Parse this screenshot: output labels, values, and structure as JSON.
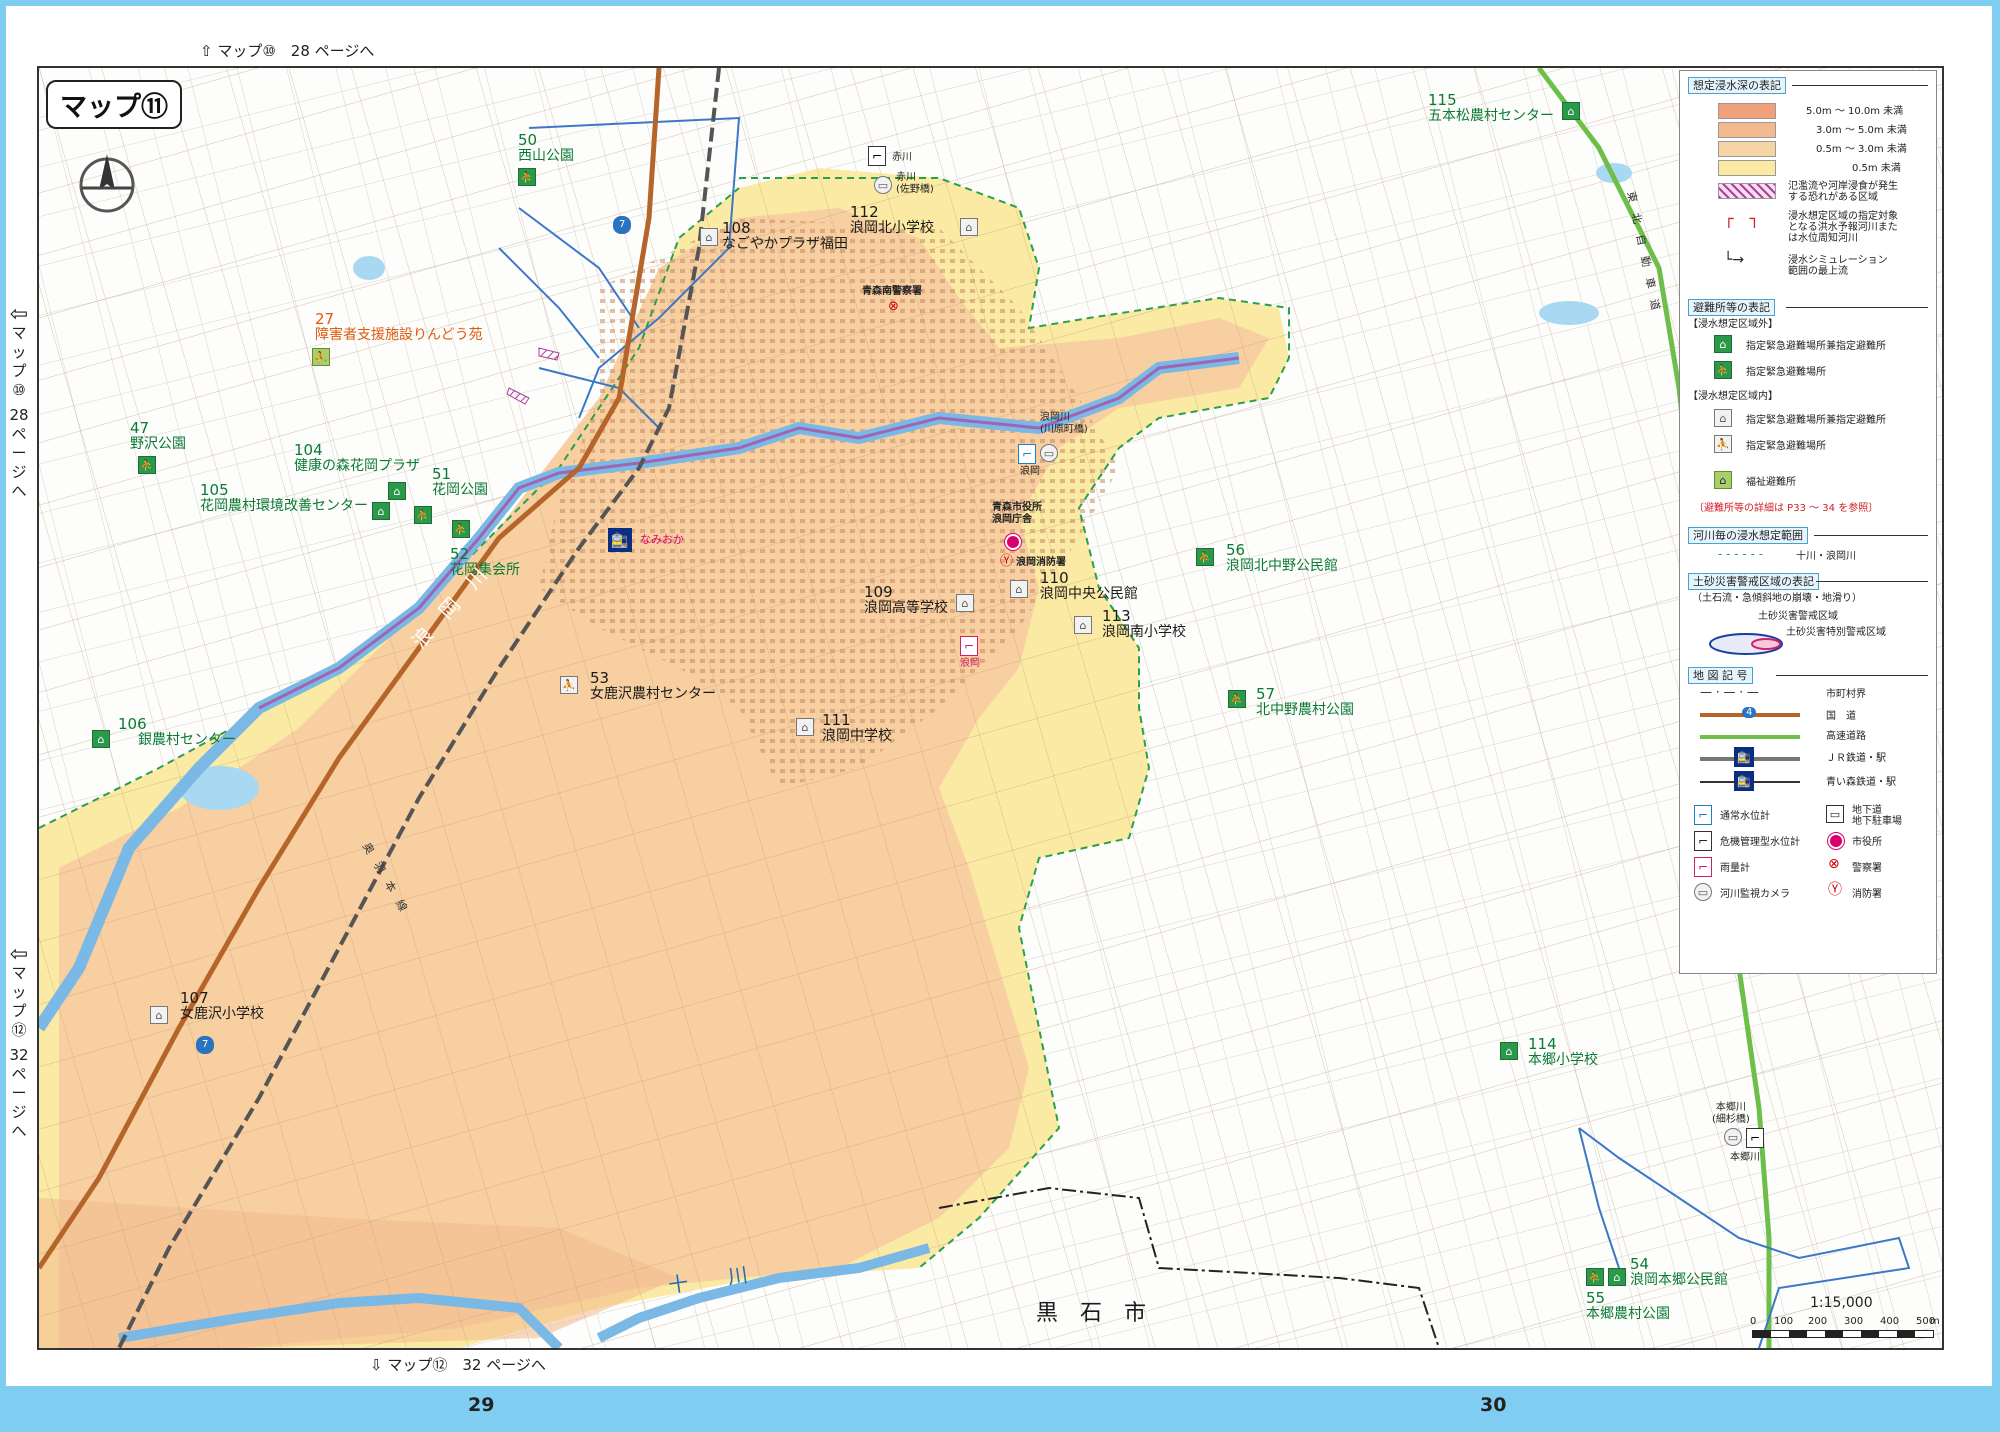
{
  "map_title": "マップ⑪",
  "nav": {
    "top": "マップ⑩　28 ページへ",
    "bottom": "マップ⑫　32 ページへ",
    "left_upper": [
      "マ",
      "ッ",
      "プ",
      "⑩",
      "",
      "28",
      "ペ",
      "ー",
      "ジ",
      "へ"
    ],
    "left_lower": [
      "マ",
      "ッ",
      "プ",
      "⑫",
      "",
      "32",
      "ペ",
      "ー",
      "ジ",
      "へ"
    ]
  },
  "page_numbers": [
    "29",
    "30"
  ],
  "facilities": [
    {
      "num": "50",
      "name": "西山公園",
      "color": "green"
    },
    {
      "num": "27",
      "name": "障害者支援施設りんどう苑",
      "color": "orange"
    },
    {
      "num": "47",
      "name": "野沢公園",
      "color": "green"
    },
    {
      "num": "104",
      "name": "健康の森花岡プラザ",
      "color": "green"
    },
    {
      "num": "51",
      "name": "花岡公園",
      "color": "green"
    },
    {
      "num": "105",
      "name": "花岡農村環境改善センター",
      "color": "green"
    },
    {
      "num": "52",
      "name": "花岡集会所",
      "color": "green"
    },
    {
      "num": "106",
      "name": "銀農村センター",
      "color": "green"
    },
    {
      "num": "107",
      "name": "女鹿沢小学校",
      "color": "black"
    },
    {
      "num": "53",
      "name": "女鹿沢農村センター",
      "color": "black"
    },
    {
      "num": "108",
      "name": "なごやかプラザ福田",
      "color": "black"
    },
    {
      "num": "112",
      "name": "浪岡北小学校",
      "color": "black"
    },
    {
      "num": "109",
      "name": "浪岡高等学校",
      "color": "black"
    },
    {
      "num": "110",
      "name": "浪岡中央公民館",
      "color": "black"
    },
    {
      "num": "113",
      "name": "浪岡南小学校",
      "color": "black"
    },
    {
      "num": "111",
      "name": "浪岡中学校",
      "color": "black"
    },
    {
      "num": "56",
      "name": "浪岡北中野公民館",
      "color": "green"
    },
    {
      "num": "57",
      "name": "北中野農村公園",
      "color": "green"
    },
    {
      "num": "115",
      "name": "五本松農村センター",
      "color": "green"
    },
    {
      "num": "114",
      "name": "本郷小学校",
      "color": "green"
    },
    {
      "num": "54",
      "name": "浪岡本郷公民館",
      "color": "green"
    },
    {
      "num": "55",
      "name": "本郷農村公園",
      "color": "green"
    }
  ],
  "places": {
    "station": "なみおか",
    "city_office": "青森市役所\n浪岡庁舎",
    "fire_station": "浪岡消防署",
    "police": "青森南警察署",
    "gauge_akagawa": "赤川",
    "akagawa_bridge": "赤川\n(佐野橋)",
    "namioka_bridge": "浪岡川\n(川原町橋)",
    "gauge_namioka": "浪岡",
    "rain_namioka": "浪岡",
    "hongo_bridge": "本郷川\n(細杉橋)",
    "gauge_hongo": "本郷川",
    "city_kuroishi": "黒　石　市",
    "river_namioka": "浪　岡　川",
    "river_jukkawa": "十　　川",
    "rail_ou": "奥　羽　本　線",
    "expressway": "東　北　自　動　車　道",
    "route7": "7"
  },
  "legend": {
    "flood_title": "想定浸水深の表記",
    "depths": [
      {
        "label": "5.0m ～ 10.0m 未満",
        "color": "#f0a17c"
      },
      {
        "label": "3.0m ～ 5.0m 未満",
        "color": "#f4b98e"
      },
      {
        "label": "0.5m ～ 3.0m 未満",
        "color": "#f7d4a6"
      },
      {
        "label": "0.5m 未満",
        "color": "#fbeaa3"
      }
    ],
    "hazard_flow": "氾濫流や河岸浸食が発生\nする恐れがある区域",
    "target_river": "浸水想定区域の指定対象\nとなる洪水予報河川また\nは水位周知河川",
    "sim_upstream": "浸水シミュレーション\n範囲の最上流",
    "shelter_title": "避難所等の表記",
    "outside_title": "【浸水想定区域外】",
    "outside_items": [
      "指定緊急避難場所兼指定避難所",
      "指定緊急避難場所"
    ],
    "inside_title": "【浸水想定区域内】",
    "inside_items": [
      "指定緊急避難場所兼指定避難所",
      "指定緊急避難場所"
    ],
    "welfare": "福祉避難所",
    "note": "〔避難所等の詳細は P33 ～ 34 を参照〕",
    "river_range_title": "河川毎の浸水想定範囲",
    "river_range_item": "十川・浪岡川",
    "sediment_title": "土砂災害警戒区域の表記",
    "sediment_sub": "（土石流・急傾斜地の崩壊・地滑り）",
    "sediment_warning": "土砂災害警戒区域",
    "sediment_special": "土砂災害特別警戒区域",
    "map_symbols_title": "地 図 記 号",
    "symbols": [
      "市町村界",
      "国　道",
      "高速道路",
      "ＪＲ鉄道・駅",
      "青い森鉄道・駅"
    ],
    "route_no": "4",
    "gauges": [
      "通常水位計",
      "危機管理型水位計",
      "雨量計",
      "河川監視カメラ"
    ],
    "right_symbols": [
      "地下道\n地下駐車場",
      "市役所",
      "警察署",
      "消防署"
    ]
  },
  "scale": {
    "ratio": "1:15,000",
    "ticks": [
      "0",
      "100",
      "200",
      "300",
      "400",
      "500"
    ],
    "unit": "m"
  },
  "colors": {
    "background": "#7fcdf0",
    "river": "#7ab8e6",
    "expressway": "#6dbf4a",
    "national_road": "#b5652a",
    "flood_boundary": "#2aa04a"
  }
}
